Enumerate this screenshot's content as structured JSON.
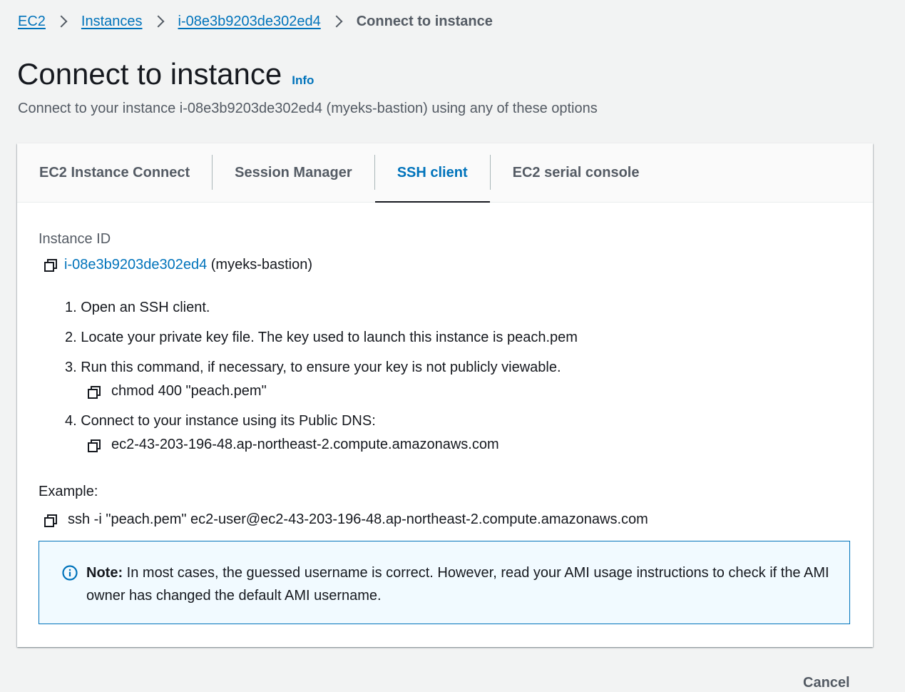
{
  "breadcrumb": {
    "items": [
      "EC2",
      "Instances",
      "i-08e3b9203de302ed4"
    ],
    "current": "Connect to instance"
  },
  "header": {
    "title": "Connect to instance",
    "info_label": "Info",
    "subtitle": "Connect to your instance i-08e3b9203de302ed4 (myeks-bastion) using any of these options"
  },
  "tabs": [
    {
      "label": "EC2 Instance Connect",
      "active": false
    },
    {
      "label": "Session Manager",
      "active": false
    },
    {
      "label": "SSH client",
      "active": true
    },
    {
      "label": "EC2 serial console",
      "active": false
    }
  ],
  "ssh": {
    "instance_id_label": "Instance ID",
    "instance_id": "i-08e3b9203de302ed4",
    "instance_name": "(myeks-bastion)",
    "steps": [
      "1. Open an SSH client.",
      "2. Locate your private key file. The key used to launch this instance is peach.pem",
      "3. Run this command, if necessary, to ensure your key is not publicly viewable.",
      "4. Connect to your instance using its Public DNS:"
    ],
    "chmod_command": "chmod 400 \"peach.pem\"",
    "public_dns": "ec2-43-203-196-48.ap-northeast-2.compute.amazonaws.com",
    "example_label": "Example:",
    "example_command": "ssh -i \"peach.pem\" ec2-user@ec2-43-203-196-48.ap-northeast-2.compute.amazonaws.com"
  },
  "note": {
    "bold": "Note:",
    "text": " In most cases, the guessed username is correct. However, read your AMI usage instructions to check if the AMI owner has changed the default AMI username."
  },
  "footer": {
    "cancel_label": "Cancel"
  },
  "colors": {
    "link": "#0073bb",
    "text": "#16191f",
    "muted": "#545b64",
    "note_bg": "#f1faff"
  }
}
